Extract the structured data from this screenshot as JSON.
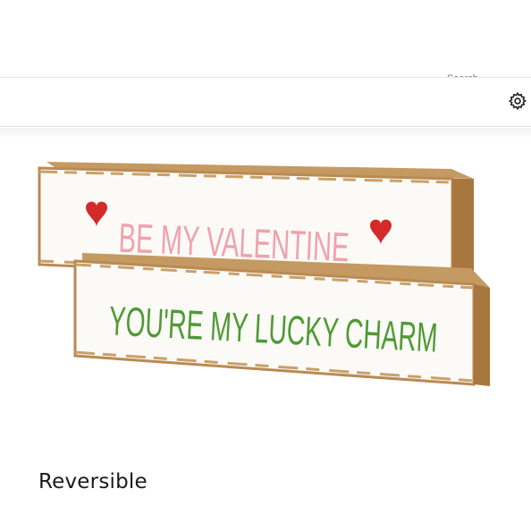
{
  "toolbar": {
    "settings_icon": "gear-icon",
    "clipped_label": "Search"
  },
  "product": {
    "sign_top_text": "BE MY VALENTINE",
    "sign_bottom_text": "YOU'RE MY LUCKY CHARM",
    "caption": "Reversible",
    "colors": {
      "heart": "#d42a2a",
      "pink_letters": "#f0a2ad",
      "green_dark": "#3d7a2e",
      "green_light": "#6cc24a",
      "wood": "#b98a52",
      "paint": "#fbfaf6"
    }
  }
}
